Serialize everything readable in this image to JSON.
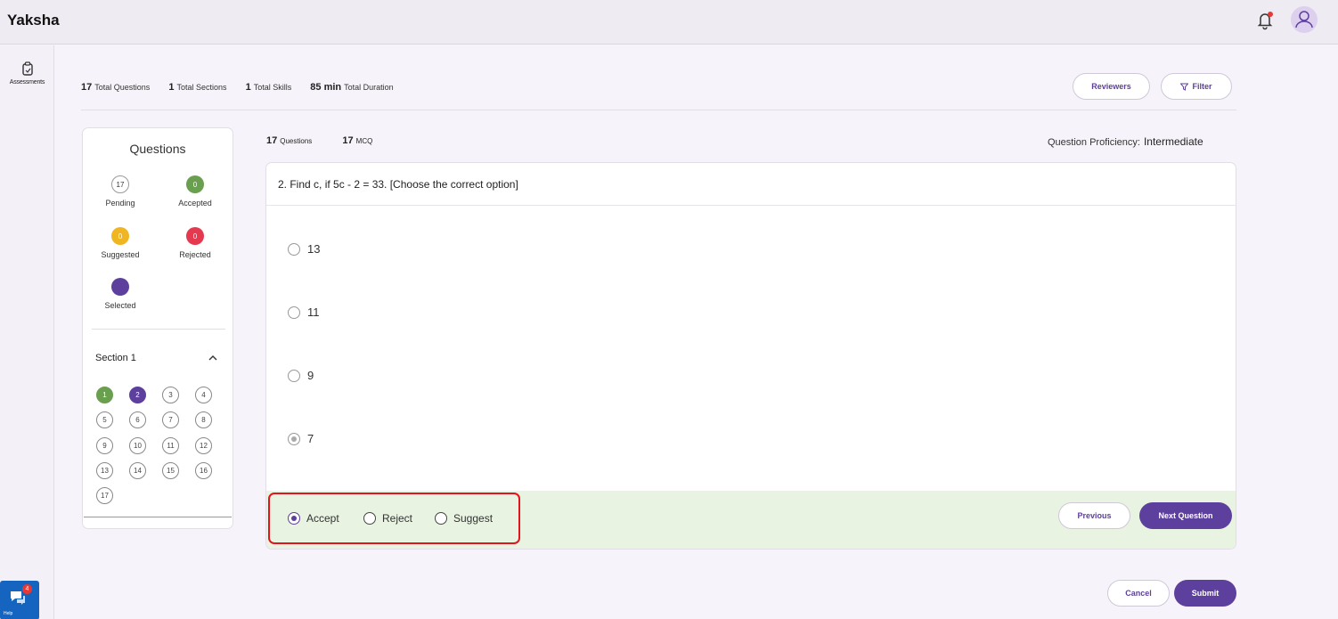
{
  "app": {
    "title": "Yaksha"
  },
  "sidenav": {
    "assessments_label": "Assessments",
    "help_badge": "4",
    "help_label": "Help"
  },
  "stats": [
    {
      "value": "17",
      "label": "Total Questions"
    },
    {
      "value": "1",
      "label": "Total Sections"
    },
    {
      "value": "1",
      "label": "Total Skills"
    },
    {
      "value": "85 min",
      "label": "Total Duration"
    }
  ],
  "toolbar": {
    "reviewers_label": "Reviewers",
    "filter_label": "Filter"
  },
  "panel": {
    "title": "Questions",
    "legend": {
      "pending": {
        "count": "17",
        "label": "Pending"
      },
      "accepted": {
        "count": "0",
        "label": "Accepted"
      },
      "suggested": {
        "count": "0",
        "label": "Suggested"
      },
      "rejected": {
        "count": "0",
        "label": "Rejected"
      },
      "selected": {
        "label": "Selected"
      }
    },
    "section": {
      "label": "Section 1"
    },
    "question_numbers": [
      "1",
      "2",
      "3",
      "4",
      "5",
      "6",
      "7",
      "8",
      "9",
      "10",
      "11",
      "12",
      "13",
      "14",
      "15",
      "16",
      "17"
    ]
  },
  "question_meta": {
    "questions_count": "17",
    "questions_label": "Questions",
    "mcq_count": "17",
    "mcq_label": "MCQ"
  },
  "proficiency": {
    "label": "Question Proficiency:",
    "value": "Intermediate"
  },
  "question": {
    "text": "2. Find c, if 5c - 2 = 33. [Choose the correct option]",
    "options": [
      "13",
      "11",
      "9",
      "7"
    ],
    "selected_option": "7"
  },
  "review": {
    "accept_label": "Accept",
    "reject_label": "Reject",
    "suggest_label": "Suggest",
    "selected": "Accept"
  },
  "nav_buttons": {
    "previous_label": "Previous",
    "next_label": "Next Question"
  },
  "footer": {
    "cancel_label": "Cancel",
    "submit_label": "Submit"
  },
  "colors": {
    "primary": "#5d3f9d",
    "accepted": "#6a9f4f",
    "suggested": "#f0b522",
    "rejected": "#e53950",
    "review_bar": "#e8f3e1",
    "highlight_border": "#e2141c"
  }
}
